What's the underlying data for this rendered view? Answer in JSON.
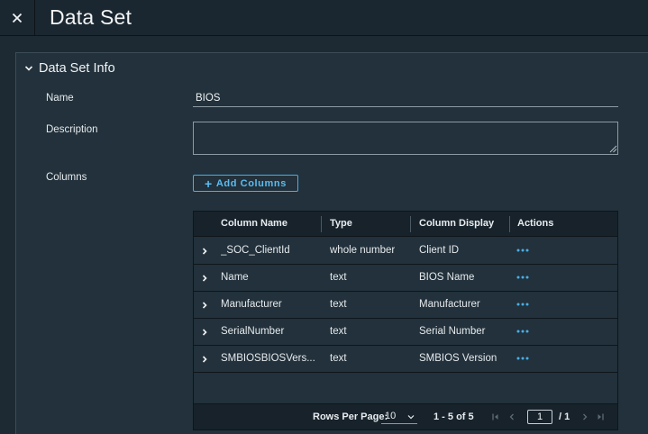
{
  "header": {
    "title": "Data Set"
  },
  "section": {
    "title": "Data Set Info"
  },
  "form": {
    "name_label": "Name",
    "name_value": "BIOS",
    "description_label": "Description",
    "description_value": "",
    "columns_label": "Columns",
    "add_columns_label": "Add Columns"
  },
  "grid": {
    "headers": [
      "Column Name",
      "Type",
      "Column Display",
      "Actions"
    ],
    "rows": [
      {
        "name": "_SOC_ClientId",
        "type": "whole number",
        "display": "Client ID"
      },
      {
        "name": "Name",
        "type": "text",
        "display": "BIOS Name"
      },
      {
        "name": "Manufacturer",
        "type": "text",
        "display": "Manufacturer"
      },
      {
        "name": "SerialNumber",
        "type": "text",
        "display": "Serial Number"
      },
      {
        "name": "SMBIOSBIOSVers...",
        "type": "text",
        "display": "SMBIOS Version"
      }
    ],
    "footer": {
      "rows_per_page_label": "Rows Per Page:",
      "rows_per_page_value": "10",
      "range_text": "1 - 5 of 5",
      "page_value": "1",
      "total_pages_text": "/ 1"
    }
  },
  "colors": {
    "background": "#1e2a33",
    "panel": "#22313b",
    "accent": "#49aee6",
    "grid_header": "#17222a"
  },
  "icons": [
    "close-icon",
    "chevron-down-icon",
    "plus-icon",
    "chevron-right-icon",
    "ellipsis-icon",
    "first-page-icon",
    "prev-page-icon",
    "next-page-icon",
    "last-page-icon"
  ]
}
